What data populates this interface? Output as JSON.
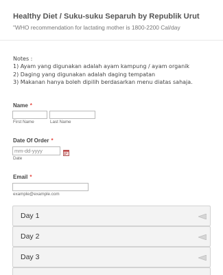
{
  "form": {
    "title": "Healthy Diet / Suku-suku Separuh by Republik Urut",
    "subtitle": "\"WHO recommendation for lactating mother is 1800-2200 Cal/day"
  },
  "notes": {
    "heading": "Notes :",
    "lines": [
      "1) Ayam yang digunakan adalah ayam kampung / ayam organik",
      "2) Daging yang digunakan adalah daging tempatan",
      "3) Makanan hanya boleh dipilih berdasarkan menu diatas sahaja."
    ]
  },
  "name_field": {
    "label": "Name",
    "required_marker": "*",
    "first_sublabel": "First Name",
    "last_sublabel": "Last Name",
    "first_value": "",
    "last_value": ""
  },
  "date_field": {
    "label": "Date Of Order",
    "required_marker": "*",
    "placeholder": "mm-dd-yyyy",
    "sublabel": "Date",
    "icon": "calendar-icon"
  },
  "email_field": {
    "label": "Email",
    "required_marker": "*",
    "sublabel": "example@example.com",
    "value": ""
  },
  "accordion": {
    "items": [
      {
        "label": "Day 1",
        "icon": "collapse-arrow-icon"
      },
      {
        "label": "Day 2",
        "icon": "collapse-arrow-icon"
      },
      {
        "label": "Day 3",
        "icon": "collapse-arrow-icon"
      }
    ]
  },
  "colors": {
    "required": "#e5453d",
    "accordion_bg": "#f3f3f3",
    "input_border": "#b9b9b9"
  }
}
